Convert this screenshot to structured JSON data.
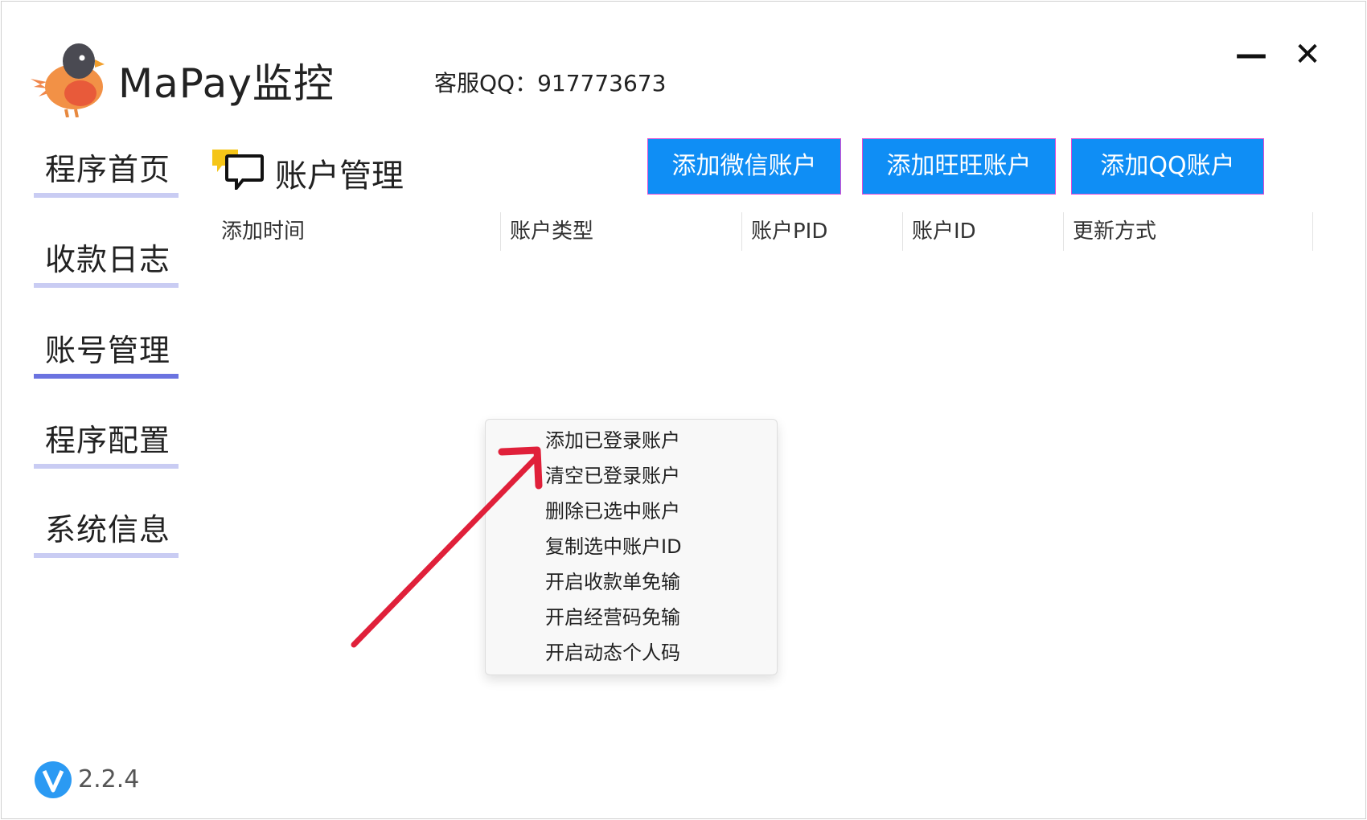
{
  "app": {
    "title": "MaPay监控",
    "support": "客服QQ：917773673",
    "minimize_glyph": "—",
    "close_glyph": "✕",
    "version": "2.2.4"
  },
  "sidebar": {
    "items": [
      {
        "label": "程序首页",
        "active": false
      },
      {
        "label": "收款日志",
        "active": false
      },
      {
        "label": "账号管理",
        "active": true
      },
      {
        "label": "程序配置",
        "active": false
      },
      {
        "label": "系统信息",
        "active": false
      }
    ]
  },
  "main": {
    "title": "账户管理",
    "buttons": {
      "wechat": "添加微信账户",
      "wangwang": "添加旺旺账户",
      "qq": "添加QQ账户"
    },
    "columns": [
      "添加时间",
      "账户类型",
      "账户PID",
      "账户ID",
      "更新方式"
    ]
  },
  "context_menu": {
    "items": [
      "添加已登录账户",
      "清空已登录账户",
      "删除已选中账户",
      "复制选中账户ID",
      "开启收款单免输",
      "开启经营码免输",
      "开启动态个人码"
    ]
  },
  "colors": {
    "accent_blue": "#0f8ef5",
    "active_underline": "#6b73e0",
    "inactive_underline": "#c9ccf3",
    "annotation_arrow": "#e0203a"
  },
  "icons": {
    "logo": "bird-logo-icon",
    "section": "chat-bubble-icon",
    "version": "v-badge-icon",
    "minimize": "minimize-icon",
    "close": "close-icon"
  }
}
